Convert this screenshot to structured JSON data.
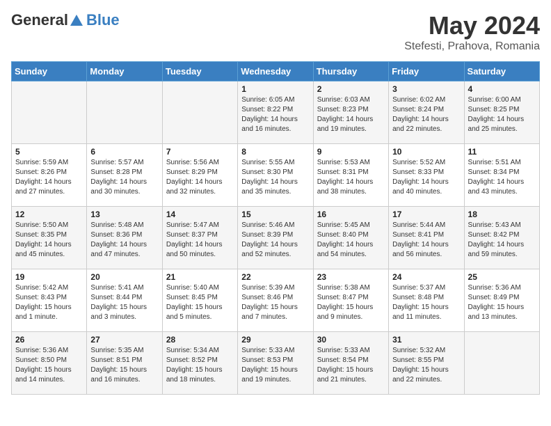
{
  "logo": {
    "line1": "General",
    "line2": "Blue"
  },
  "header": {
    "title": "May 2024",
    "subtitle": "Stefesti, Prahova, Romania"
  },
  "days_of_week": [
    "Sunday",
    "Monday",
    "Tuesday",
    "Wednesday",
    "Thursday",
    "Friday",
    "Saturday"
  ],
  "weeks": [
    [
      {
        "day": "",
        "info": ""
      },
      {
        "day": "",
        "info": ""
      },
      {
        "day": "",
        "info": ""
      },
      {
        "day": "1",
        "info": "Sunrise: 6:05 AM\nSunset: 8:22 PM\nDaylight: 14 hours and 16 minutes."
      },
      {
        "day": "2",
        "info": "Sunrise: 6:03 AM\nSunset: 8:23 PM\nDaylight: 14 hours and 19 minutes."
      },
      {
        "day": "3",
        "info": "Sunrise: 6:02 AM\nSunset: 8:24 PM\nDaylight: 14 hours and 22 minutes."
      },
      {
        "day": "4",
        "info": "Sunrise: 6:00 AM\nSunset: 8:25 PM\nDaylight: 14 hours and 25 minutes."
      }
    ],
    [
      {
        "day": "5",
        "info": "Sunrise: 5:59 AM\nSunset: 8:26 PM\nDaylight: 14 hours and 27 minutes."
      },
      {
        "day": "6",
        "info": "Sunrise: 5:57 AM\nSunset: 8:28 PM\nDaylight: 14 hours and 30 minutes."
      },
      {
        "day": "7",
        "info": "Sunrise: 5:56 AM\nSunset: 8:29 PM\nDaylight: 14 hours and 32 minutes."
      },
      {
        "day": "8",
        "info": "Sunrise: 5:55 AM\nSunset: 8:30 PM\nDaylight: 14 hours and 35 minutes."
      },
      {
        "day": "9",
        "info": "Sunrise: 5:53 AM\nSunset: 8:31 PM\nDaylight: 14 hours and 38 minutes."
      },
      {
        "day": "10",
        "info": "Sunrise: 5:52 AM\nSunset: 8:33 PM\nDaylight: 14 hours and 40 minutes."
      },
      {
        "day": "11",
        "info": "Sunrise: 5:51 AM\nSunset: 8:34 PM\nDaylight: 14 hours and 43 minutes."
      }
    ],
    [
      {
        "day": "12",
        "info": "Sunrise: 5:50 AM\nSunset: 8:35 PM\nDaylight: 14 hours and 45 minutes."
      },
      {
        "day": "13",
        "info": "Sunrise: 5:48 AM\nSunset: 8:36 PM\nDaylight: 14 hours and 47 minutes."
      },
      {
        "day": "14",
        "info": "Sunrise: 5:47 AM\nSunset: 8:37 PM\nDaylight: 14 hours and 50 minutes."
      },
      {
        "day": "15",
        "info": "Sunrise: 5:46 AM\nSunset: 8:39 PM\nDaylight: 14 hours and 52 minutes."
      },
      {
        "day": "16",
        "info": "Sunrise: 5:45 AM\nSunset: 8:40 PM\nDaylight: 14 hours and 54 minutes."
      },
      {
        "day": "17",
        "info": "Sunrise: 5:44 AM\nSunset: 8:41 PM\nDaylight: 14 hours and 56 minutes."
      },
      {
        "day": "18",
        "info": "Sunrise: 5:43 AM\nSunset: 8:42 PM\nDaylight: 14 hours and 59 minutes."
      }
    ],
    [
      {
        "day": "19",
        "info": "Sunrise: 5:42 AM\nSunset: 8:43 PM\nDaylight: 15 hours and 1 minute."
      },
      {
        "day": "20",
        "info": "Sunrise: 5:41 AM\nSunset: 8:44 PM\nDaylight: 15 hours and 3 minutes."
      },
      {
        "day": "21",
        "info": "Sunrise: 5:40 AM\nSunset: 8:45 PM\nDaylight: 15 hours and 5 minutes."
      },
      {
        "day": "22",
        "info": "Sunrise: 5:39 AM\nSunset: 8:46 PM\nDaylight: 15 hours and 7 minutes."
      },
      {
        "day": "23",
        "info": "Sunrise: 5:38 AM\nSunset: 8:47 PM\nDaylight: 15 hours and 9 minutes."
      },
      {
        "day": "24",
        "info": "Sunrise: 5:37 AM\nSunset: 8:48 PM\nDaylight: 15 hours and 11 minutes."
      },
      {
        "day": "25",
        "info": "Sunrise: 5:36 AM\nSunset: 8:49 PM\nDaylight: 15 hours and 13 minutes."
      }
    ],
    [
      {
        "day": "26",
        "info": "Sunrise: 5:36 AM\nSunset: 8:50 PM\nDaylight: 15 hours and 14 minutes."
      },
      {
        "day": "27",
        "info": "Sunrise: 5:35 AM\nSunset: 8:51 PM\nDaylight: 15 hours and 16 minutes."
      },
      {
        "day": "28",
        "info": "Sunrise: 5:34 AM\nSunset: 8:52 PM\nDaylight: 15 hours and 18 minutes."
      },
      {
        "day": "29",
        "info": "Sunrise: 5:33 AM\nSunset: 8:53 PM\nDaylight: 15 hours and 19 minutes."
      },
      {
        "day": "30",
        "info": "Sunrise: 5:33 AM\nSunset: 8:54 PM\nDaylight: 15 hours and 21 minutes."
      },
      {
        "day": "31",
        "info": "Sunrise: 5:32 AM\nSunset: 8:55 PM\nDaylight: 15 hours and 22 minutes."
      },
      {
        "day": "",
        "info": ""
      }
    ]
  ]
}
